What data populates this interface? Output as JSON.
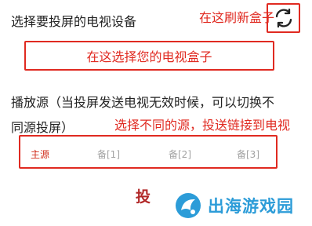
{
  "title": "选择要投屏的电视设备",
  "annotations": {
    "refresh": "在这刷新盒子",
    "device": "在这选择您的电视盒子",
    "source": "选择不同的源，投送链接到电视"
  },
  "source_description": {
    "line1": "播放源（当投屏发送电视无效时候，可以切换不",
    "line2": "同源投屏）"
  },
  "source_tabs": [
    {
      "label": "主源",
      "active": true
    },
    {
      "label": "备[1]",
      "active": false
    },
    {
      "label": "备[2]",
      "active": false
    },
    {
      "label": "备[3]",
      "active": false
    }
  ],
  "cast_button": "投",
  "watermark": {
    "text": "出海游戏园"
  },
  "colors": {
    "accent_red": "#e02a21",
    "active_tab": "#d2301f",
    "inactive_tab": "#a3a3a3",
    "cast_button": "#b12727",
    "watermark_blue": "#2c9cd8"
  },
  "icons": {
    "refresh": "refresh-icon",
    "watermark_logo": "logo-icon"
  }
}
